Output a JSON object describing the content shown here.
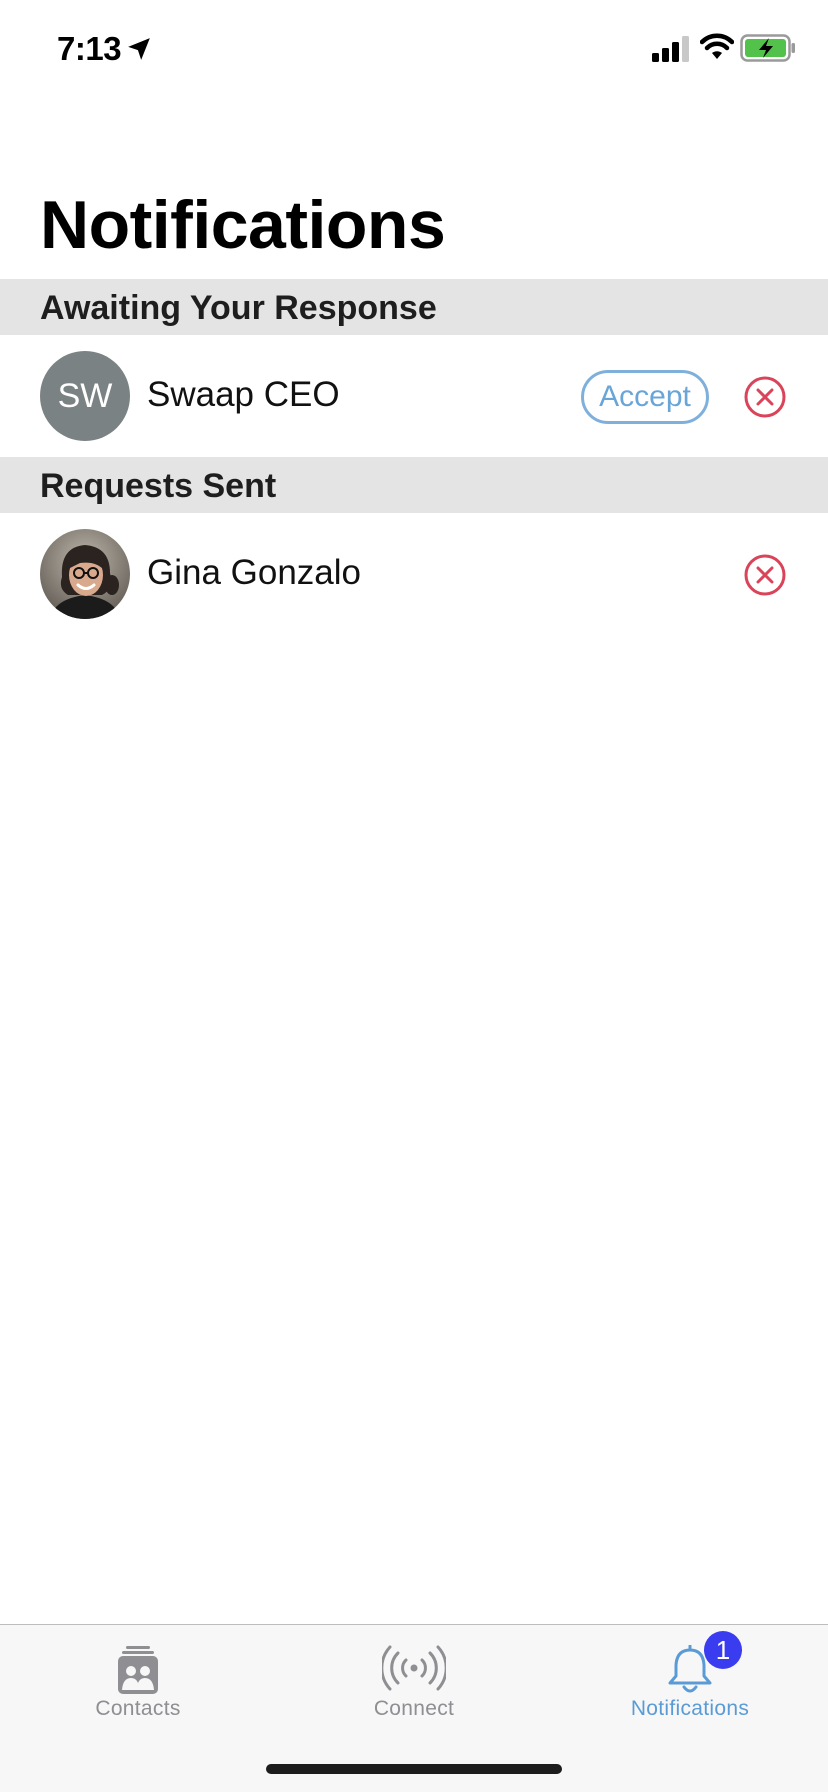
{
  "status_bar": {
    "time": "7:13",
    "icons": [
      "location-arrow-icon",
      "cellular-signal-icon",
      "wifi-icon",
      "battery-charging-icon"
    ]
  },
  "page": {
    "title": "Notifications"
  },
  "sections": {
    "awaiting": {
      "header": "Awaiting Your Response",
      "items": [
        {
          "initials": "SW",
          "name": "Swaap CEO",
          "accept_label": "Accept"
        }
      ]
    },
    "sent": {
      "header": "Requests Sent",
      "items": [
        {
          "name": "Gina Gonzalo"
        }
      ]
    }
  },
  "tab_bar": {
    "tabs": [
      {
        "label": "Contacts",
        "icon": "contacts-icon",
        "active": false
      },
      {
        "label": "Connect",
        "icon": "broadcast-icon",
        "active": false
      },
      {
        "label": "Notifications",
        "icon": "bell-icon",
        "active": true,
        "badge": "1"
      }
    ]
  },
  "colors": {
    "accent": "#5b9bd5",
    "dismiss": "#d9445a",
    "badge": "#3a3cf0",
    "section_bg": "#e4e4e4",
    "avatar_bg": "#7b8283"
  }
}
